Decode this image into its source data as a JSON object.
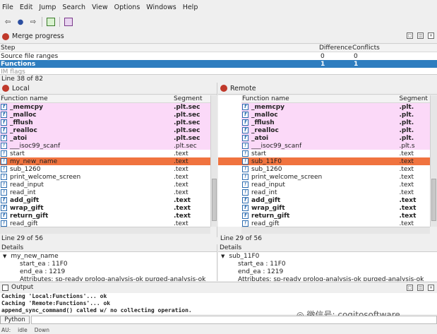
{
  "menu": [
    "File",
    "Edit",
    "Jump",
    "Search",
    "View",
    "Options",
    "Windows",
    "Help"
  ],
  "merge": {
    "title": "Merge progress",
    "columns": [
      "Step",
      "Difference",
      "Conflicts"
    ],
    "rows": [
      {
        "step": "Source file ranges",
        "diff": "0",
        "conf": "0"
      },
      {
        "step": "Functions",
        "diff": "1",
        "conf": "1"
      },
      {
        "step": "IM flags",
        "diff": "",
        "conf": ""
      }
    ],
    "line_status": "Line 38 of 82"
  },
  "local": {
    "title": "Local",
    "columns": [
      "Function name",
      "Segment"
    ],
    "line_status": "Line 29 of 56",
    "rows": [
      {
        "name": "_memcpy",
        "seg": ".plt.sec",
        "style": "pink-bold"
      },
      {
        "name": "_malloc",
        "seg": ".plt.sec",
        "style": "pink-bold"
      },
      {
        "name": "_fflush",
        "seg": ".plt.sec",
        "style": "pink-bold"
      },
      {
        "name": "_realloc",
        "seg": ".plt.sec",
        "style": "pink-bold"
      },
      {
        "name": "_atoi",
        "seg": ".plt.sec",
        "style": "pink-bold"
      },
      {
        "name": "___isoc99_scanf",
        "seg": ".plt.sec",
        "style": "pink"
      },
      {
        "name": "start",
        "seg": ".text",
        "style": "normal"
      },
      {
        "name": "my_new_name",
        "seg": ".text",
        "style": "orange"
      },
      {
        "name": "sub_1260",
        "seg": ".text",
        "style": "normal"
      },
      {
        "name": "print_welcome_screen",
        "seg": ".text",
        "style": "normal"
      },
      {
        "name": "read_input",
        "seg": ".text",
        "style": "normal"
      },
      {
        "name": "read_int",
        "seg": ".text",
        "style": "normal"
      },
      {
        "name": "add_gift",
        "seg": ".text",
        "style": "bold"
      },
      {
        "name": "wrap_gift",
        "seg": ".text",
        "style": "bold"
      },
      {
        "name": "return_gift",
        "seg": ".text",
        "style": "bold"
      },
      {
        "name": "read_gift",
        "seg": ".text",
        "style": "normal"
      }
    ]
  },
  "remote": {
    "title": "Remote",
    "columns": [
      "Function name",
      "Segment"
    ],
    "line_status": "Line 29 of 56",
    "rows": [
      {
        "name": "_memcpy",
        "seg": ".plt.",
        "style": "pink-bold"
      },
      {
        "name": "_malloc",
        "seg": ".plt.",
        "style": "pink-bold"
      },
      {
        "name": "_fflush",
        "seg": ".plt.",
        "style": "pink-bold"
      },
      {
        "name": "_realloc",
        "seg": ".plt.",
        "style": "pink-bold"
      },
      {
        "name": "_atoi",
        "seg": ".plt.",
        "style": "pink-bold"
      },
      {
        "name": "___isoc99_scanf",
        "seg": ".plt.s",
        "style": "pink"
      },
      {
        "name": "start",
        "seg": ".text",
        "style": "normal"
      },
      {
        "name": "sub_11F0",
        "seg": ".text",
        "style": "orange"
      },
      {
        "name": "sub_1260",
        "seg": ".text",
        "style": "normal"
      },
      {
        "name": "print_welcome_screen",
        "seg": ".text",
        "style": "normal"
      },
      {
        "name": "read_input",
        "seg": ".text",
        "style": "normal"
      },
      {
        "name": "read_int",
        "seg": ".text",
        "style": "normal"
      },
      {
        "name": "add_gift",
        "seg": ".text",
        "style": "bold"
      },
      {
        "name": "wrap_gift",
        "seg": ".text",
        "style": "bold"
      },
      {
        "name": "return_gift",
        "seg": ".text",
        "style": "bold"
      },
      {
        "name": "read_gift",
        "seg": ".text",
        "style": "normal"
      }
    ]
  },
  "details_left": {
    "title": "Details",
    "root": "my_new_name",
    "start": "start_ea : 11F0",
    "end": "end_ea : 1219",
    "attrs": "Attributes: sp-ready prolog-analysis-ok purged-analysis-ok"
  },
  "details_right": {
    "title": "Details",
    "root": "sub_11F0",
    "start": "start_ea : 11F0",
    "end": "end_ea : 1219",
    "attrs": "Attributes: sp-ready prolog-analysis-ok purged-analysis-ok"
  },
  "output": {
    "title": "Output",
    "lines": [
      "Caching 'Local:Functions'... ok",
      "Caching 'Remote:Functions'... ok",
      "append_sync_command() called w/ no collecting operation."
    ],
    "watermark": "微信号: cogitosoftware",
    "lang_button": "Python",
    "status": [
      "AU:",
      "idle",
      "Down"
    ]
  },
  "colors": {
    "selection": "#2e7dbf",
    "pink": "#fbd9f8",
    "orange": "#f0733f"
  }
}
